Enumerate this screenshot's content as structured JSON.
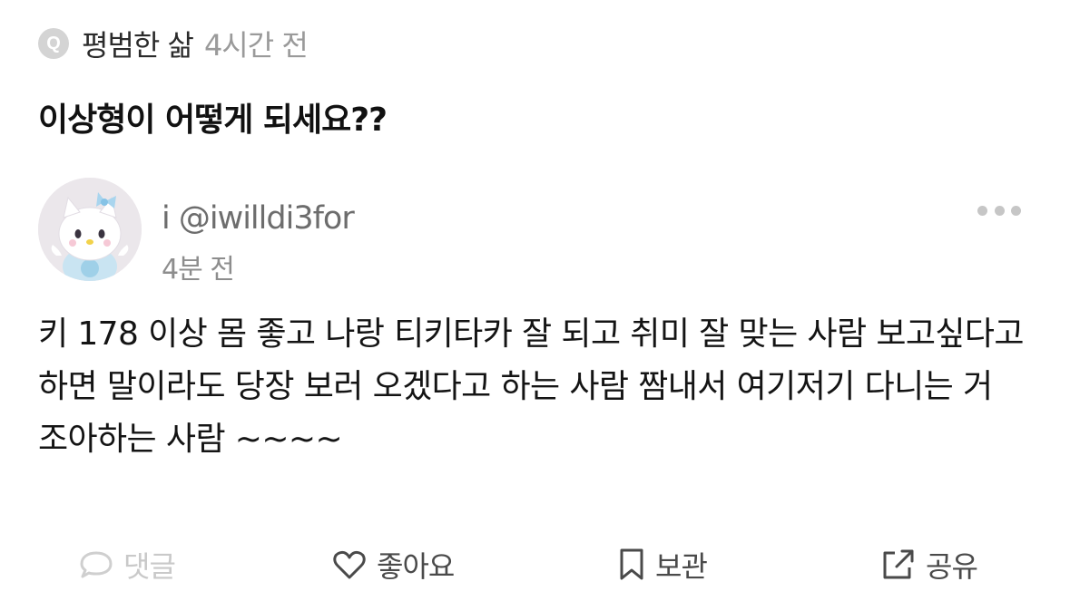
{
  "question": {
    "badge": "Q",
    "asker_name": "평범한 삶",
    "asked_time": "4시간 전",
    "title": "이상형이 어떻게 되세요??"
  },
  "answer": {
    "display_name": "i @iwilldi3for",
    "time": "4분 전",
    "body": "키 178 이상 몸 좋고 나랑 티키타카 잘 되고 취미 잘 맞는 사람 보고싶다고 하면 말이라도 당장 보러 오겠다고 하는 사람 짬내서 여기저기 다니는 거 조아하는 사람 ~~~~"
  },
  "actions": {
    "comment_label": "댓글",
    "like_label": "좋아요",
    "save_label": "보관",
    "share_label": "공유"
  },
  "icons": {
    "more": "more-dots-icon",
    "comment": "speech-bubble-icon",
    "like": "heart-icon",
    "save": "bookmark-icon",
    "share": "share-icon"
  }
}
